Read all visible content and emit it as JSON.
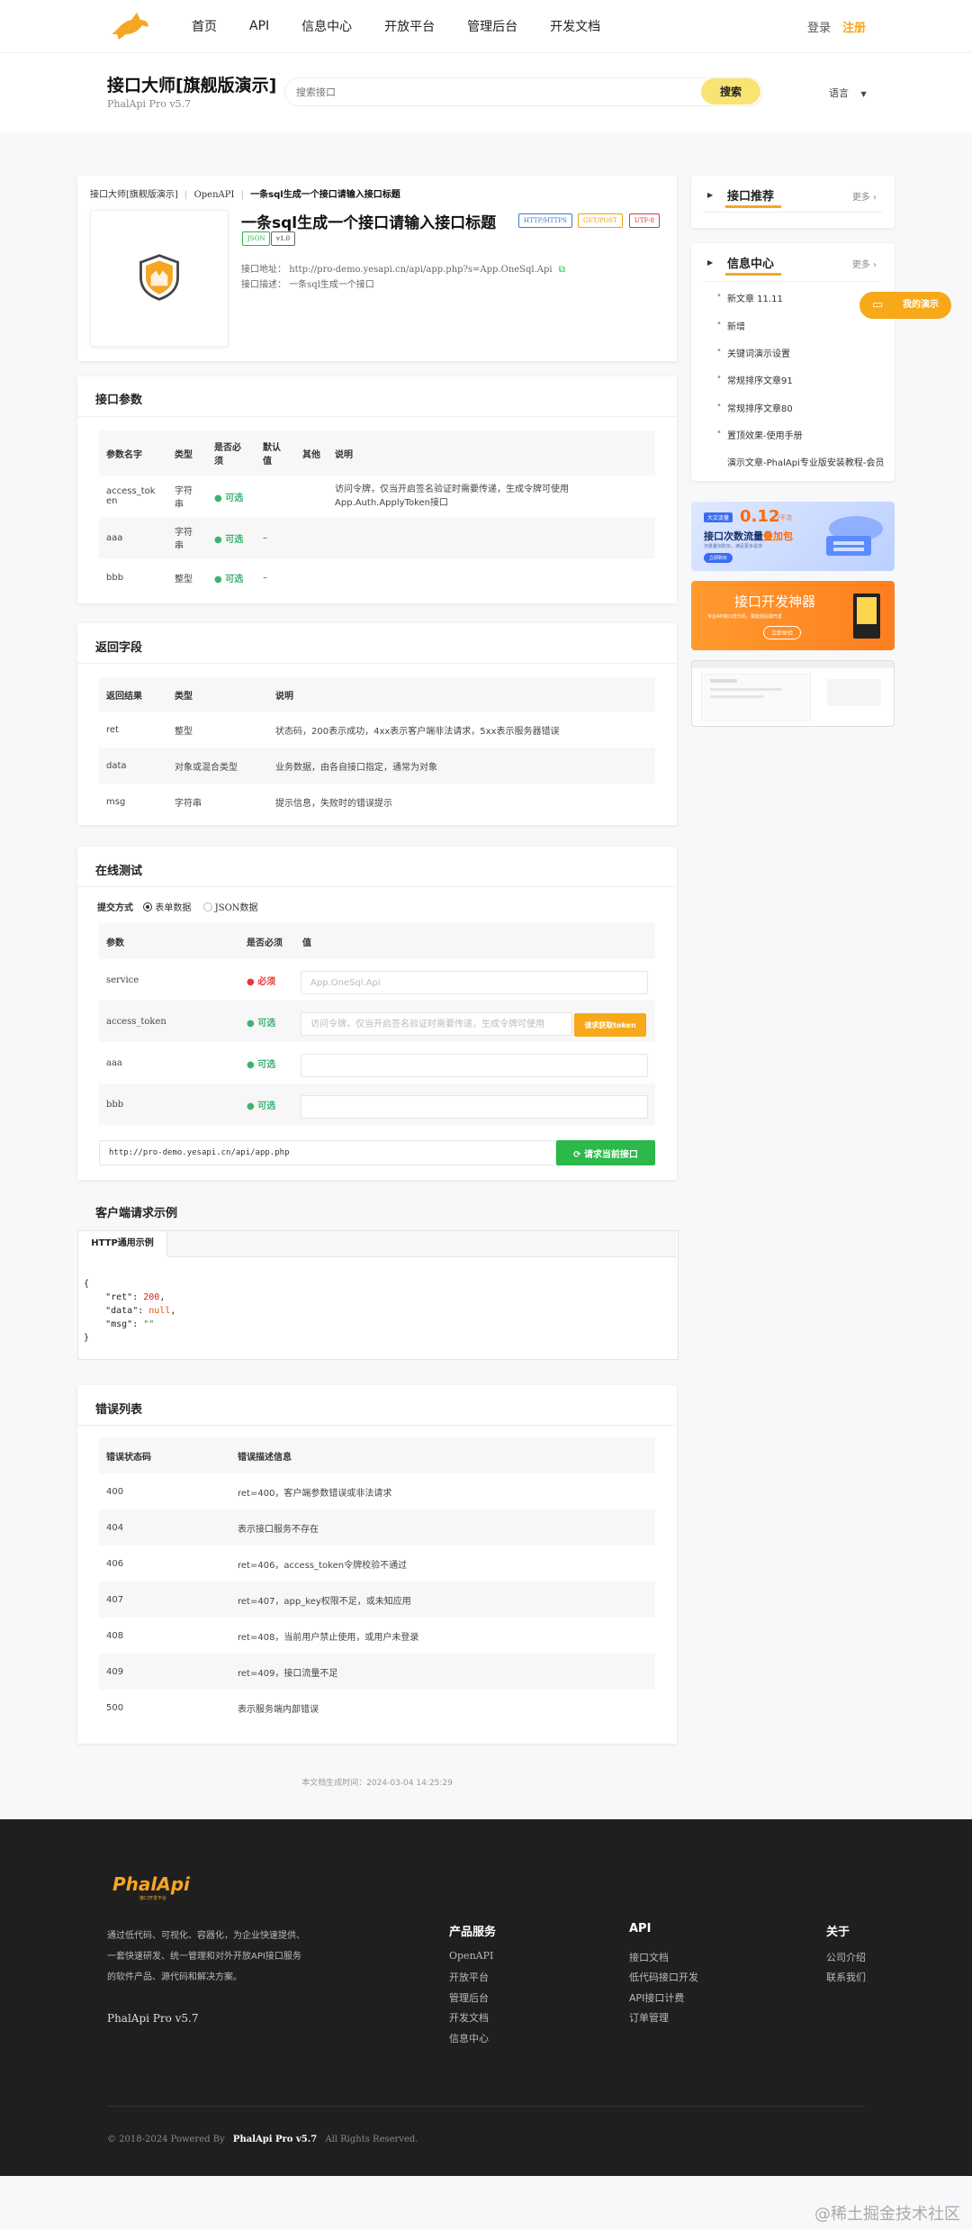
{
  "nav": {
    "links": [
      "首页",
      "API",
      "信息中心",
      "开放平台",
      "管理后台",
      "开发文档"
    ],
    "login": "登录",
    "register": "注册"
  },
  "header": {
    "title": "接口大师[旗舰版演示]",
    "version": "PhalApi Pro v5.7",
    "search_placeholder": "搜索接口",
    "search_button": "搜索",
    "language": "语言"
  },
  "api": {
    "breadcrumb": [
      "接口大师[旗舰版演示]",
      "OpenAPI",
      "一条sql生成一个接口请输入接口标题"
    ],
    "title": "一条sql生成一个接口请输入接口标题",
    "tags": [
      "HTTP/HTTPS",
      "GET/POST",
      "UTF-8",
      "JSON",
      "v1.0"
    ],
    "address_label": "接口地址：",
    "address": "http://pro-demo.yesapi.cn/api/app.php?s=App.OneSql.Api",
    "desc_label": "接口描述：",
    "desc": "一条sql生成一个接口"
  },
  "params": {
    "title": "接口参数",
    "headers": [
      "参数名字",
      "类型",
      "是否必须",
      "默认值",
      "其他",
      "说明"
    ],
    "rows": [
      {
        "name": "access_token",
        "type": "字符串",
        "required": "可选",
        "default": "",
        "other": "",
        "desc": "访问令牌，仅当开启签名验证时需要传递，生成令牌可使用App.Auth.ApplyToken接口"
      },
      {
        "name": "aaa",
        "type": "字符串",
        "required": "可选",
        "default": "–",
        "other": "",
        "desc": ""
      },
      {
        "name": "bbb",
        "type": "整型",
        "required": "可选",
        "default": "–",
        "other": "",
        "desc": ""
      }
    ]
  },
  "returns": {
    "title": "返回字段",
    "headers": [
      "返回结果",
      "类型",
      "说明"
    ],
    "rows": [
      {
        "name": "ret",
        "type": "整型",
        "desc": "状态码，200表示成功，4xx表示客户端非法请求，5xx表示服务器错误"
      },
      {
        "name": "data",
        "type": "对象或混合类型",
        "desc": "业务数据，由各自接口指定，通常为对象"
      },
      {
        "name": "msg",
        "type": "字符串",
        "desc": "提示信息，失败时的错误提示"
      }
    ]
  },
  "test": {
    "title": "在线测试",
    "submit_label": "提交方式",
    "mode_form": "表单数据",
    "mode_json": "JSON数据",
    "headers": [
      "参数",
      "是否必须",
      "值"
    ],
    "rows": [
      {
        "name": "service",
        "required": "必须",
        "value": "App.OneSql.Api"
      },
      {
        "name": "access_token",
        "required": "可选",
        "value": "访问令牌，仅当开启签名验证时需要传递，生成令牌可使用"
      },
      {
        "name": "aaa",
        "required": "可选",
        "value": ""
      },
      {
        "name": "bbb",
        "required": "可选",
        "value": ""
      }
    ],
    "token_button": "请求获取token",
    "url": "http://pro-demo.yesapi.cn/api/app.php",
    "request_button": "请求当前接口"
  },
  "client": {
    "title": "客户端请求示例",
    "tab": "HTTP通用示例",
    "code_open": "{",
    "code_ret_key": "\"ret\"",
    "code_ret_val": "200",
    "code_data_key": "\"data\"",
    "code_data_val": "null",
    "code_msg_key": "\"msg\"",
    "code_msg_val": "\"\"",
    "code_close": "}"
  },
  "errors": {
    "title": "错误列表",
    "headers": [
      "错误状态码",
      "错误描述信息"
    ],
    "rows": [
      {
        "code": "400",
        "desc": "ret=400，客户端参数错误或非法请求"
      },
      {
        "code": "404",
        "desc": "表示接口服务不存在"
      },
      {
        "code": "406",
        "desc": "ret=406，access_token令牌校验不通过"
      },
      {
        "code": "407",
        "desc": "ret=407，app_key权限不足，或未知应用"
      },
      {
        "code": "408",
        "desc": "ret=408，当前用户禁止使用，或用户未登录"
      },
      {
        "code": "409",
        "desc": "ret=409，接口流量不足"
      },
      {
        "code": "500",
        "desc": "表示服务端内部错误"
      }
    ]
  },
  "generated": "本文档生成时间：2024-03-04 14:25:29",
  "sidebar": {
    "recommend_title": "接口推荐",
    "more": "更多",
    "info_title": "信息中心",
    "info_items": [
      "新文章 11.11",
      "新增",
      "关键词演示设置",
      "常规排序文章91",
      "常规排序文章80",
      "置顶效果-使用手册",
      "演示文章-PhalApi专业版安装教程-会员"
    ],
    "demo_button": "我的演示",
    "banner1_tag": "大文流量",
    "banner1_big": "0.12",
    "banner1_unit": "/千次",
    "banner1_title": "接口次数流量",
    "banner1_highlight": "叠加包",
    "banner1_sub": "流量叠加购买，满足更多需求",
    "banner1_btn": "立即购买",
    "banner2_title": "接口开发神器",
    "banner2_sub": "专业API接口低代码，赋能前后端开发",
    "banner2_btn": "立即体验"
  },
  "footer": {
    "logo_text": "PhalApi",
    "logo_sub": "接口开发平台",
    "intro": [
      "通过低代码、可视化、容器化，为企业快速提供、",
      "一套快速研发、统一管理和对外开放API接口服务",
      "的软件产品、源代码和解决方案。"
    ],
    "version": "PhalApi Pro v5.7",
    "col1_title": "产品服务",
    "col1": [
      "OpenAPI",
      "开放平台",
      "管理后台",
      "开发文档",
      "信息中心"
    ],
    "col2_title": "API",
    "col2": [
      "接口文档",
      "低代码接口开发",
      "API接口计费",
      "订单管理"
    ],
    "col3_title": "关于",
    "col3": [
      "公司介绍",
      "联系我们"
    ],
    "copyright_pre": "© 2018-2024 Powered By",
    "copyright_brand": "PhalApi Pro v5.7",
    "copyright_post": "All Rights Reserved."
  },
  "watermark": "@稀土掘金技术社区",
  "colors": {
    "accent": "#f5a623",
    "green": "#2cb84a",
    "orange_btn": "#f7a91a",
    "footer_bg": "#1f1f1f"
  }
}
